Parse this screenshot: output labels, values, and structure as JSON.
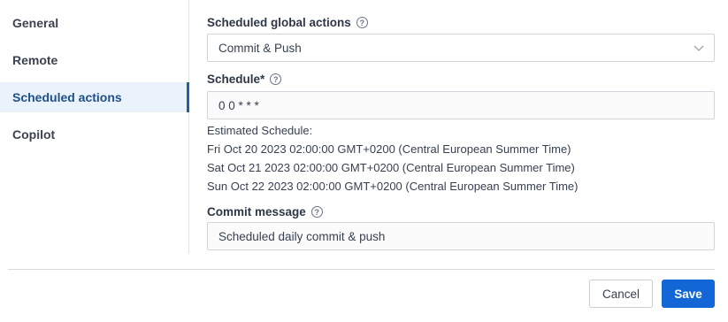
{
  "sidebar": {
    "items": [
      {
        "label": "General"
      },
      {
        "label": "Remote"
      },
      {
        "label": "Scheduled actions"
      },
      {
        "label": "Copilot"
      }
    ]
  },
  "form": {
    "scheduled_actions_label": "Scheduled global actions",
    "scheduled_actions_value": "Commit & Push",
    "schedule_label": "Schedule*",
    "schedule_value": "0 0 * * *",
    "estimated_title": "Estimated Schedule:",
    "estimated_lines": [
      "Fri Oct 20 2023 02:00:00 GMT+0200 (Central European Summer Time)",
      "Sat Oct 21 2023 02:00:00 GMT+0200 (Central European Summer Time)",
      "Sun Oct 22 2023 02:00:00 GMT+0200 (Central European Summer Time)"
    ],
    "commit_message_label": "Commit message",
    "commit_message_value": "Scheduled daily commit & push"
  },
  "footer": {
    "cancel_label": "Cancel",
    "save_label": "Save"
  },
  "colors": {
    "accent": "#1266d6",
    "active_bg": "#eaf3fb",
    "active_border": "#1f5fa6"
  },
  "icons": {
    "help": "question-circle-icon",
    "dropdown": "chevron-down-icon"
  }
}
